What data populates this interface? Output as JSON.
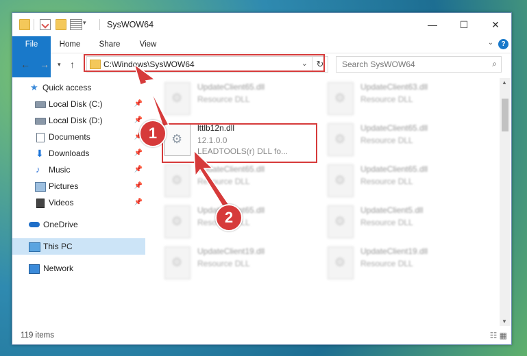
{
  "window": {
    "title": "SysWOW64",
    "buttons": {
      "minimize": "—",
      "maximize": "☐",
      "close": "✕"
    }
  },
  "ribbon": {
    "tabs": [
      "File",
      "Home",
      "Share",
      "View"
    ],
    "help": "?"
  },
  "nav": {
    "address": "C:\\Windows\\SysWOW64",
    "search_placeholder": "Search SysWOW64"
  },
  "sidebar": {
    "items": [
      {
        "label": "Quick access",
        "icon": "star-icon"
      },
      {
        "label": "Local Disk (C:)",
        "icon": "drive-icon",
        "pinned": true
      },
      {
        "label": "Local Disk (D:)",
        "icon": "drive-icon",
        "pinned": true
      },
      {
        "label": "Documents",
        "icon": "documents-icon",
        "pinned": true
      },
      {
        "label": "Downloads",
        "icon": "downloads-icon",
        "pinned": true
      },
      {
        "label": "Music",
        "icon": "music-icon",
        "pinned": true
      },
      {
        "label": "Pictures",
        "icon": "pictures-icon",
        "pinned": true
      },
      {
        "label": "Videos",
        "icon": "videos-icon",
        "pinned": true
      },
      {
        "label": "OneDrive",
        "icon": "onedrive-icon"
      },
      {
        "label": "This PC",
        "icon": "this-pc-icon",
        "selected": true
      },
      {
        "label": "Network",
        "icon": "network-icon"
      }
    ]
  },
  "files": {
    "col1": [
      {
        "name": "UpdateClient65.dll",
        "type": "Resource DLL"
      },
      {
        "name": "lttlb12n.dll",
        "version": "12.1.0.0",
        "description": "LEADTOOLS(r) DLL fo..."
      },
      {
        "name": "UpdateClient65.dll",
        "type": "Resource DLL"
      },
      {
        "name": "UpdateClient65.dll",
        "type": "Resource DLL"
      },
      {
        "name": "UpdateClient19.dll",
        "type": "Resource DLL"
      }
    ],
    "col2": [
      {
        "name": "UpdateClient63.dll",
        "type": "Resource DLL"
      },
      {
        "name": "UpdateClient65.dll",
        "type": "Resource DLL"
      },
      {
        "name": "UpdateClient65.dll",
        "type": "Resource DLL"
      },
      {
        "name": "UpdateClient5.dll",
        "type": "Resource DLL"
      },
      {
        "name": "UpdateClient19.dll",
        "type": "Resource DLL"
      }
    ]
  },
  "status": {
    "count": "119 items"
  },
  "callouts": {
    "one": "1",
    "two": "2"
  },
  "colors": {
    "accent": "#1979ca",
    "highlight": "#d63a3a",
    "selected": "#cce4f7"
  }
}
